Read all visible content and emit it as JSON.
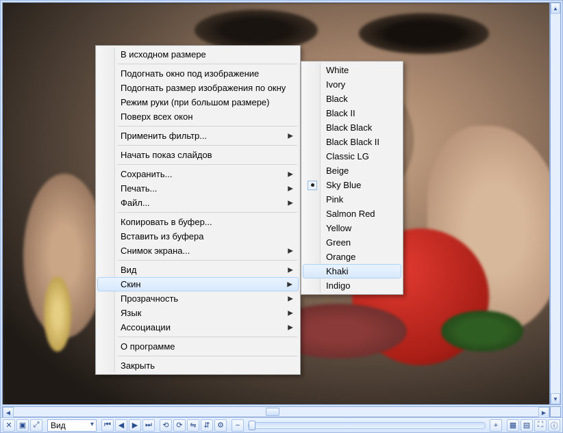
{
  "context_menu": {
    "items": [
      {
        "label": "В исходном размере",
        "submenu": false
      },
      {
        "sep": true
      },
      {
        "label": "Подогнать окно под изображение",
        "submenu": false
      },
      {
        "label": "Подогнать размер изображения по окну",
        "submenu": false
      },
      {
        "label": "Режим руки (при большом размере)",
        "submenu": false
      },
      {
        "label": "Поверх всех окон",
        "submenu": false
      },
      {
        "sep": true
      },
      {
        "label": "Применить фильтр...",
        "submenu": true
      },
      {
        "sep": true
      },
      {
        "label": "Начать показ слайдов",
        "submenu": false
      },
      {
        "sep": true
      },
      {
        "label": "Сохранить...",
        "submenu": true
      },
      {
        "label": "Печать...",
        "submenu": true
      },
      {
        "label": "Файл...",
        "submenu": true
      },
      {
        "sep": true
      },
      {
        "label": "Копировать в буфер...",
        "submenu": false
      },
      {
        "label": "Вставить из буфера",
        "submenu": false
      },
      {
        "label": "Снимок экрана...",
        "submenu": true
      },
      {
        "sep": true
      },
      {
        "label": "Вид",
        "submenu": true
      },
      {
        "label": "Скин",
        "submenu": true,
        "highlight": true
      },
      {
        "label": "Прозрачность",
        "submenu": true
      },
      {
        "label": "Язык",
        "submenu": true
      },
      {
        "label": "Ассоциации",
        "submenu": true
      },
      {
        "sep": true
      },
      {
        "label": "О программе",
        "submenu": false
      },
      {
        "sep": true
      },
      {
        "label": "Закрыть",
        "submenu": false
      }
    ]
  },
  "skin_submenu": {
    "items": [
      {
        "label": "White"
      },
      {
        "label": "Ivory"
      },
      {
        "label": "Black"
      },
      {
        "label": "Black II"
      },
      {
        "label": "Black Black"
      },
      {
        "label": "Black Black II"
      },
      {
        "label": "Classic LG"
      },
      {
        "label": "Beige"
      },
      {
        "label": "Sky Blue",
        "selected": true
      },
      {
        "label": "Pink"
      },
      {
        "label": "Salmon Red"
      },
      {
        "label": "Yellow"
      },
      {
        "label": "Green"
      },
      {
        "label": "Orange"
      },
      {
        "label": "Khaki",
        "highlight": true
      },
      {
        "label": "Indigo"
      }
    ]
  },
  "toolbar": {
    "mode_label": "Вид"
  }
}
